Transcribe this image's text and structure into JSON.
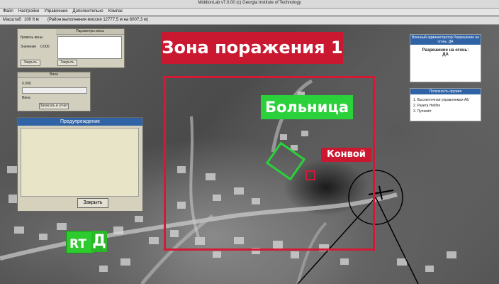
{
  "window": {
    "title": "MiddionLab v7.0.00  (c) Georgia Institute of Technology"
  },
  "menu": [
    "Файл",
    "Настройки",
    "Управление",
    "Дополнительно",
    "Компас"
  ],
  "infobar": {
    "scale_label": "Масштаб",
    "scale_value": "100 ft м",
    "status": "(Район выполнения миссии 12777,5 м на 6007,3 м)"
  },
  "panel1": {
    "title": "Параметры вины",
    "label1": "Уровень вины",
    "label2": "Значение",
    "value": "0.000",
    "btn1": "Закрыть",
    "btn2": "Закрыть"
  },
  "panel2": {
    "title": "Вина",
    "value": "0.000",
    "label": "Вина",
    "btn": "Записать в отчет"
  },
  "warning": {
    "title": "Предупреждение",
    "close": "Закрыть"
  },
  "zone": {
    "title": "Зона поражения 1"
  },
  "hospital": {
    "label": "Больница"
  },
  "convoy": {
    "label": "Конвой"
  },
  "right_panel1": {
    "header": "Военный администратор Разрешение на огонь: ДА",
    "line1": "Разрешение на огонь:",
    "line2": "ДА"
  },
  "right_panel2": {
    "header": "Полезность оружия",
    "items": [
      "1. Высокоточная управляемая АБ",
      "2. Ракета Hellfire",
      "3. Пулемёт"
    ]
  },
  "logo": {
    "text1": "RT",
    "text2": "Д"
  },
  "colors": {
    "zone_red": "#d21a36",
    "hospital_green": "#2ad13a",
    "header_blue": "#2f63a6"
  }
}
